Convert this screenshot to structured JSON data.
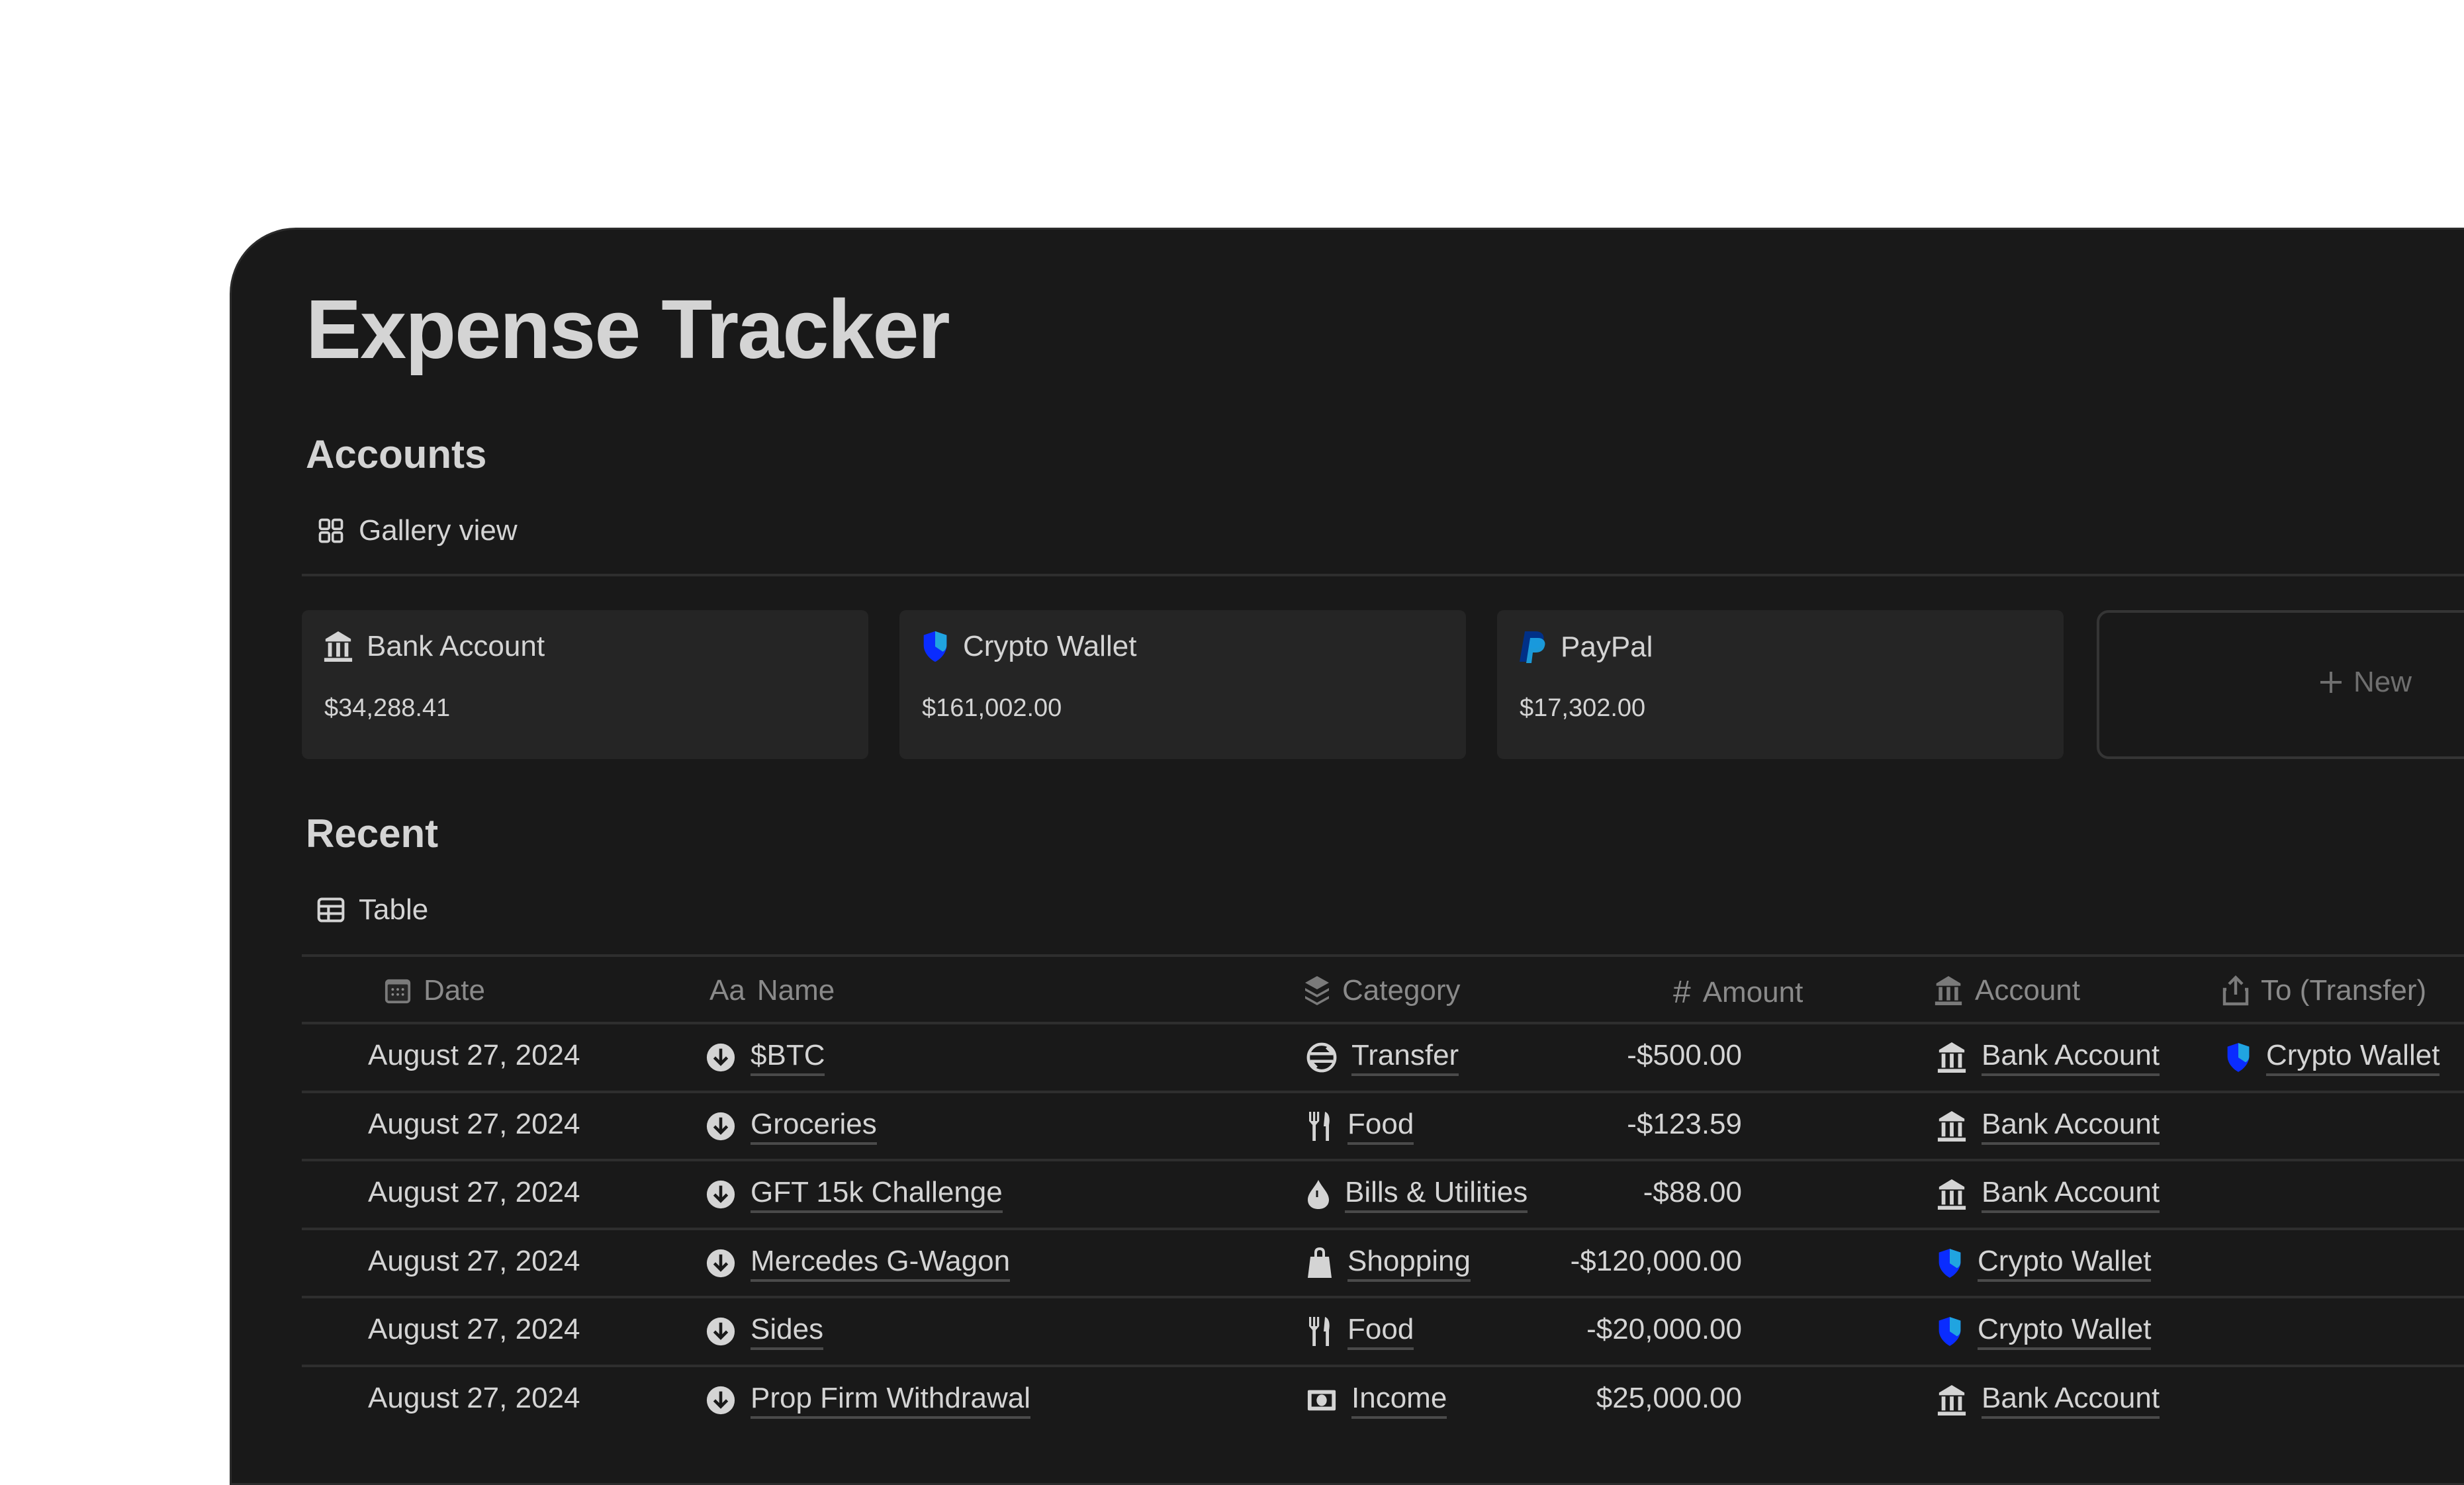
{
  "page": {
    "title": "Expense Tracker"
  },
  "accounts": {
    "heading": "Accounts",
    "view_label": "Gallery view",
    "cards": [
      {
        "name": "Bank Account",
        "icon": "bank-icon",
        "balance": "$34,288.41"
      },
      {
        "name": "Crypto Wallet",
        "icon": "shield-icon",
        "balance": "$161,002.00"
      },
      {
        "name": "PayPal",
        "icon": "paypal-icon",
        "balance": "$17,302.00"
      }
    ],
    "new_label": "New"
  },
  "recent": {
    "heading": "Recent",
    "view_label": "Table",
    "columns": [
      "Date",
      "Name",
      "Category",
      "Amount",
      "Account",
      "To (Transfer)"
    ],
    "column_icons": [
      "calendar-icon",
      "text-icon",
      "layers-icon",
      "hash-icon",
      "bank-icon",
      "share-icon"
    ],
    "rows": [
      {
        "date": "August 27, 2024",
        "name": "$BTC",
        "category": "Transfer",
        "category_icon": "transfer-icon",
        "amount": "-$500.00",
        "account": "Bank Account",
        "to": "Crypto Wallet"
      },
      {
        "date": "August 27, 2024",
        "name": "Groceries",
        "category": "Food",
        "category_icon": "utensils-icon",
        "amount": "-$123.59",
        "account": "Bank Account",
        "to": ""
      },
      {
        "date": "August 27, 2024",
        "name": "GFT 15k Challenge",
        "category": "Bills & Utilities",
        "category_icon": "drop-icon",
        "amount": "-$88.00",
        "account": "Bank Account",
        "to": ""
      },
      {
        "date": "August 27, 2024",
        "name": "Mercedes G-Wagon",
        "category": "Shopping",
        "category_icon": "bag-icon",
        "amount": "-$120,000.00",
        "account": "Crypto Wallet",
        "to": ""
      },
      {
        "date": "August 27, 2024",
        "name": "Sides",
        "category": "Food",
        "category_icon": "utensils-icon",
        "amount": "-$20,000.00",
        "account": "Crypto Wallet",
        "to": ""
      },
      {
        "date": "August 27, 2024",
        "name": "Prop Firm Withdrawal",
        "category": "Income",
        "category_icon": "cash-icon",
        "amount": "$25,000.00",
        "account": "Bank Account",
        "to": ""
      }
    ]
  },
  "colors": {
    "background": "#191919",
    "card": "#252525",
    "text": "#d4d4d4",
    "muted": "#8a8a8a",
    "crypto_blue": "#0a2cff",
    "paypal_dark": "#003087",
    "paypal_light": "#1a9fe0"
  }
}
